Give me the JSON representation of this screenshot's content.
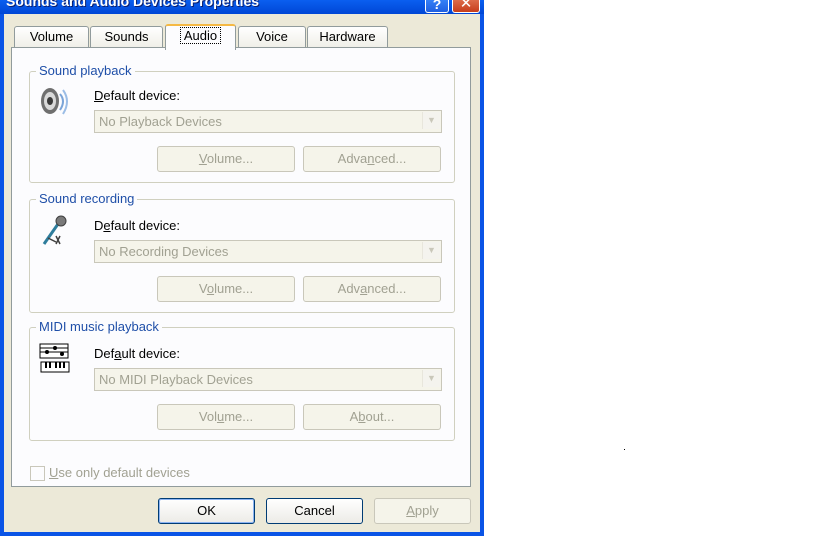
{
  "window": {
    "title": "Sounds and Audio Devices Properties",
    "help_glyph": "?",
    "close_glyph": "✕"
  },
  "tabs": [
    {
      "label": "Volume"
    },
    {
      "label": "Sounds"
    },
    {
      "label": "Audio",
      "active": true
    },
    {
      "label": "Voice"
    },
    {
      "label": "Hardware"
    }
  ],
  "playback": {
    "title": "Sound playback",
    "label_pre": "",
    "label_u": "D",
    "label_post": "efault device:",
    "device": "No Playback Devices",
    "btn1_pre": "",
    "btn1_u": "V",
    "btn1_post": "olume...",
    "btn2_pre": "Adva",
    "btn2_u": "n",
    "btn2_post": "ced..."
  },
  "recording": {
    "title": "Sound recording",
    "label_pre": "D",
    "label_u": "e",
    "label_post": "fault device:",
    "device": "No Recording Devices",
    "btn1_pre": "V",
    "btn1_u": "o",
    "btn1_post": "lume...",
    "btn2_pre": "Adv",
    "btn2_u": "a",
    "btn2_post": "nced..."
  },
  "midi": {
    "title": "MIDI music playback",
    "label_pre": "Def",
    "label_u": "a",
    "label_post": "ult device:",
    "device": "No MIDI Playback Devices",
    "btn1_pre": "Vol",
    "btn1_u": "u",
    "btn1_post": "me...",
    "btn2_pre": "A",
    "btn2_u": "b",
    "btn2_post": "out..."
  },
  "options": {
    "default_only_u": "U",
    "default_only_rest": "se only default devices",
    "default_only_checked": false
  },
  "footer": {
    "ok": "OK",
    "cancel": "Cancel",
    "apply_u": "A",
    "apply_rest": "pply"
  },
  "colors": {
    "title_bar": "#0a54e6",
    "group_title": "#1f4fa8",
    "disabled_text": "#a1a192",
    "close_button": "#c63d1b"
  }
}
